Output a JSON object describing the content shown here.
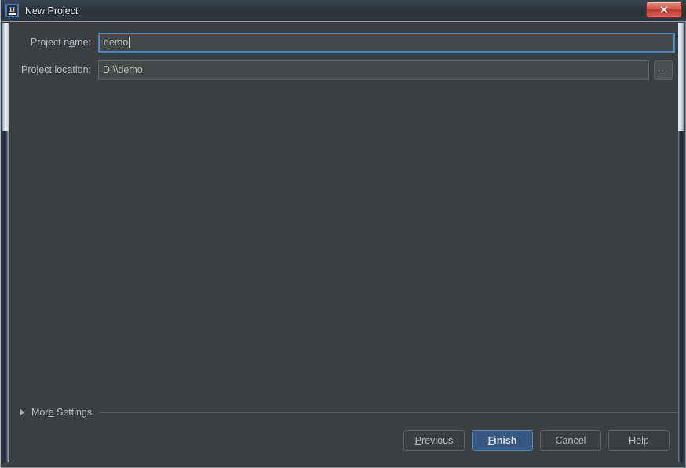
{
  "window": {
    "title": "New Project",
    "app_icon": "intellij-idea-icon",
    "icon_text": "IJ",
    "close_label": "✕",
    "close_icon": "close-icon"
  },
  "form": {
    "rows": [
      {
        "label_pre": "Project n",
        "label_mnemonic": "a",
        "label_post": "me:",
        "value": "demo",
        "focused": true,
        "has_browse": false
      },
      {
        "label_pre": "Project ",
        "label_mnemonic": "l",
        "label_post": "ocation:",
        "value": "D:\\\\demo",
        "focused": false,
        "has_browse": true
      }
    ],
    "browse_label": "...",
    "browse_icon": "ellipsis-icon"
  },
  "more_settings": {
    "label_pre": "Mor",
    "label_mnemonic": "e",
    "label_post": " Settings",
    "expanded": false,
    "chevron_icon": "triangle-right-icon"
  },
  "buttons": [
    {
      "name": "previous-button",
      "pre": "",
      "mnemonic": "P",
      "post": "revious",
      "primary": false
    },
    {
      "name": "finish-button",
      "pre": "",
      "mnemonic": "F",
      "post": "inish",
      "primary": true
    },
    {
      "name": "cancel-button",
      "pre": "Cancel",
      "mnemonic": "",
      "post": "",
      "primary": false
    },
    {
      "name": "help-button",
      "pre": "Help",
      "mnemonic": "",
      "post": "",
      "primary": false
    }
  ],
  "colors": {
    "background": "#3c3f41",
    "titlebar": "#2c3740",
    "accent_blue": "#365880",
    "focus_border": "#4a88c7",
    "text": "#bbbbbb",
    "close_red": "#bb382c",
    "input_bg": "#45494a"
  }
}
